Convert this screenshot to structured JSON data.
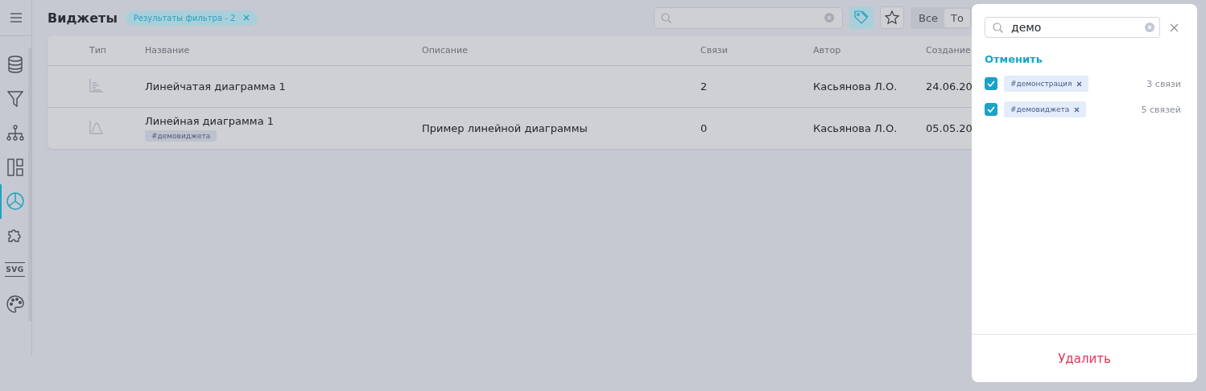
{
  "sidebar": {
    "items": [
      {
        "kind": "database",
        "selected": false
      },
      {
        "kind": "filter",
        "selected": false
      },
      {
        "kind": "hierarchy",
        "selected": false
      },
      {
        "kind": "layout",
        "selected": false
      },
      {
        "kind": "pie",
        "selected": true
      },
      {
        "kind": "puzzle",
        "selected": false
      },
      {
        "kind": "svg",
        "label": "SVG",
        "selected": false
      },
      {
        "kind": "palette",
        "selected": false
      }
    ]
  },
  "header": {
    "title": "Виджеты",
    "filter_badge": "Результаты фильтра - 2",
    "tag_filter_active": true,
    "segments": [
      {
        "label": "Все",
        "selected": false
      },
      {
        "label": "То",
        "selected": true
      }
    ]
  },
  "table": {
    "columns": [
      "Тип",
      "Название",
      "Описание",
      "Связи",
      "Автор",
      "Создание"
    ],
    "rows": [
      {
        "kind": "bar",
        "name": "Линейчатая диаграмма 1",
        "links": "2",
        "author": "Касьянова Л.О.",
        "created": "24.06.20"
      },
      {
        "kind": "line",
        "name": "Линейная диаграмма 1",
        "tags": [
          "#демовиджета"
        ],
        "description": "Пример линейной диаграммы",
        "links": "0",
        "author": "Касьянова Л.О.",
        "created": "05.05.20"
      }
    ]
  },
  "drawer": {
    "search": {
      "value": "демо"
    },
    "cancel": "Отменить",
    "tags": [
      {
        "label": "#демонстрация",
        "checked": true,
        "count": "3 связи"
      },
      {
        "label": "#демовиджета",
        "checked": true,
        "count": "5 связей"
      }
    ],
    "delete": "Удалить"
  }
}
